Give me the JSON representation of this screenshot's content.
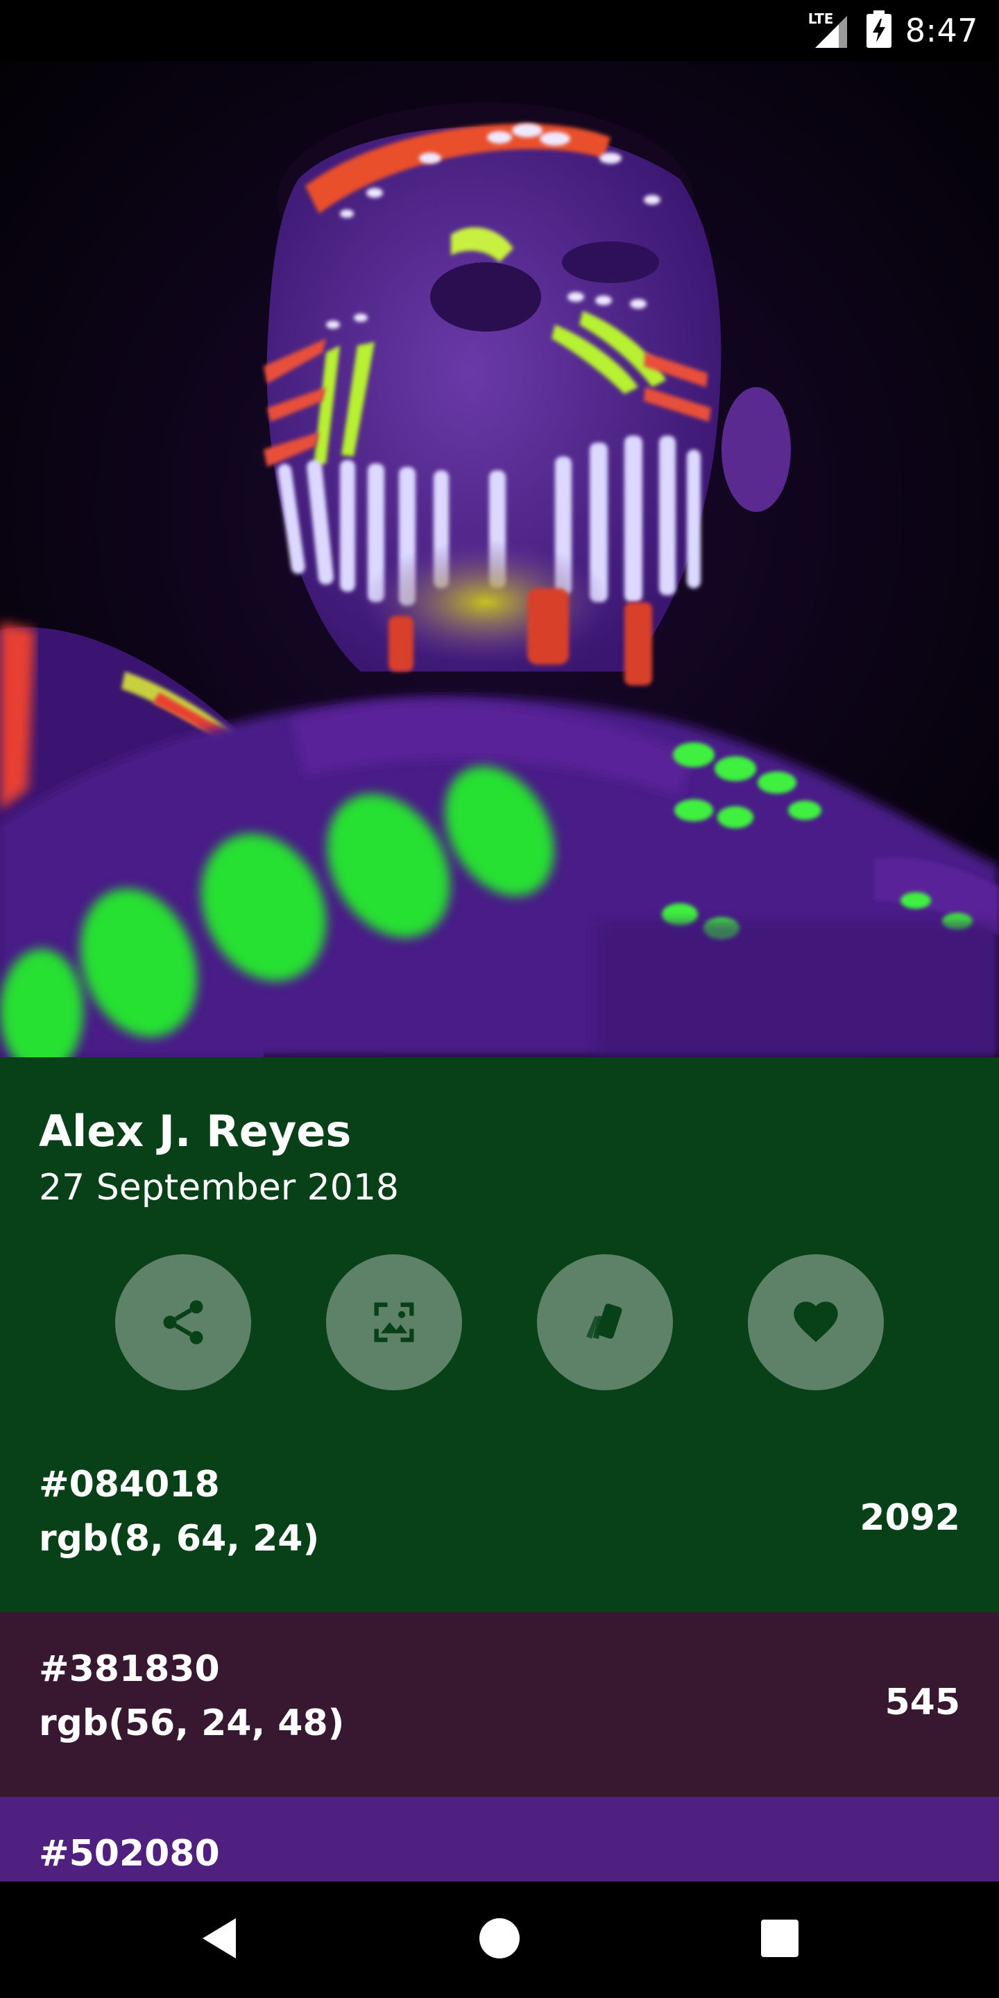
{
  "status_bar": {
    "network": "LTE",
    "time": "8:47",
    "icons": [
      "signal-icon",
      "battery-charging-icon"
    ]
  },
  "photo": {
    "author": "Alex J. Reyes",
    "date": "27 September 2018"
  },
  "actions": [
    {
      "name": "share",
      "icon": "share-icon"
    },
    {
      "name": "set-wallpaper",
      "icon": "wallpaper-icon"
    },
    {
      "name": "palette",
      "icon": "swatches-icon"
    },
    {
      "name": "favorite",
      "icon": "heart-icon"
    }
  ],
  "colors": [
    {
      "hex": "#084018",
      "rgb": "rgb(8, 64, 24)",
      "count": "2092",
      "bg": "#084018"
    },
    {
      "hex": "#381830",
      "rgb": "rgb(56, 24, 48)",
      "count": "545",
      "bg": "#381830"
    },
    {
      "hex": "#502080",
      "rgb": "",
      "count": "",
      "bg": "#502080"
    }
  ],
  "nav": {
    "icons": [
      "back-icon",
      "home-icon",
      "recents-icon"
    ]
  },
  "theme": {
    "accent": "#084018",
    "button_bg": "#5e8268"
  }
}
